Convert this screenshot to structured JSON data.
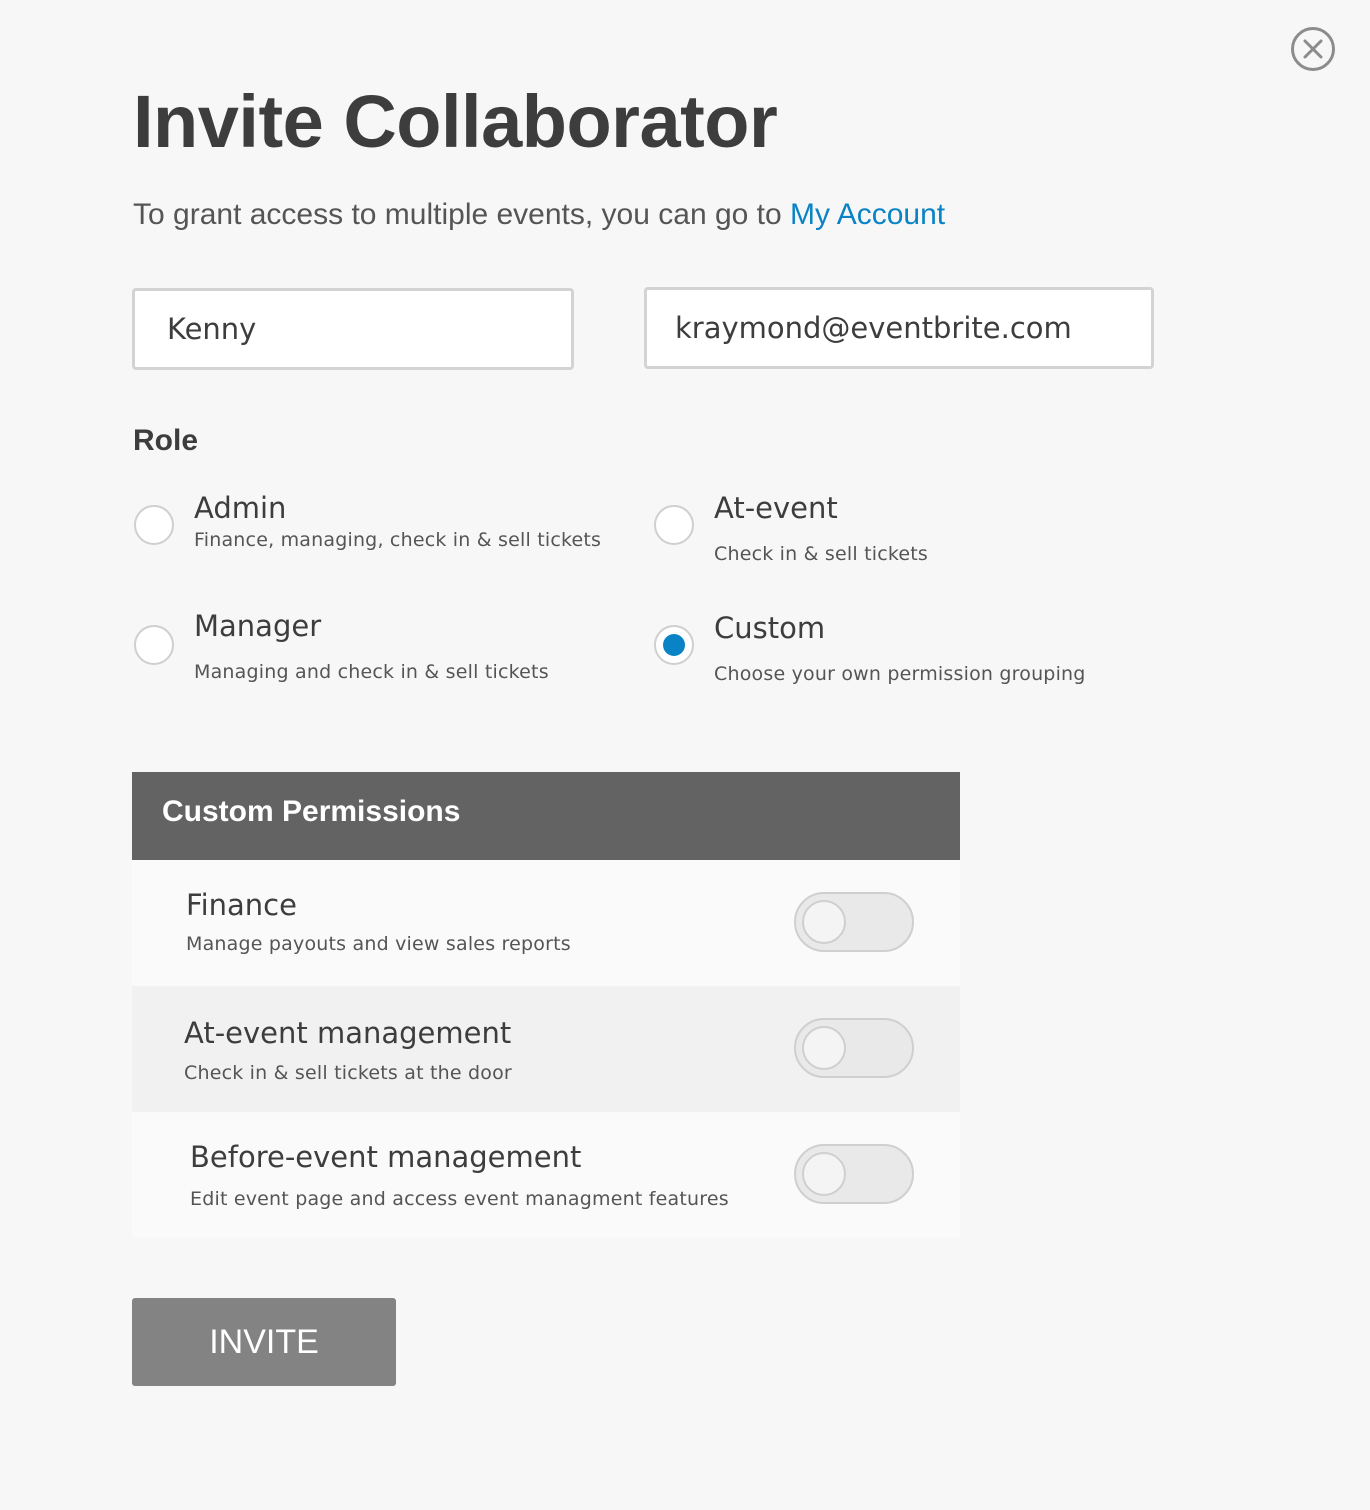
{
  "dialog": {
    "title": "Invite Collaborator",
    "subtitle_text": "To grant access to multiple events, you can go to ",
    "subtitle_link": "My Account",
    "close_icon": "close-icon"
  },
  "form": {
    "name_value": "Kenny",
    "email_value": "kraymond@eventbrite.com"
  },
  "role": {
    "label": "Role",
    "selected": "Custom",
    "options": [
      {
        "title": "Admin",
        "description": "Finance, managing, check in & sell tickets",
        "checked": false
      },
      {
        "title": "At-event",
        "description": "Check in & sell tickets",
        "checked": false
      },
      {
        "title": "Manager",
        "description": "Managing and check in & sell tickets",
        "checked": false
      },
      {
        "title": "Custom",
        "description": "Choose your own permission grouping",
        "checked": true
      }
    ]
  },
  "permissions": {
    "header": "Custom Permissions",
    "items": [
      {
        "title": "Finance",
        "description": "Manage payouts and view sales reports",
        "enabled": false
      },
      {
        "title": "At-event management",
        "description": "Check in & sell tickets at the door",
        "enabled": false
      },
      {
        "title": "Before-event management",
        "description": "Edit event page and access event managment features",
        "enabled": false
      }
    ]
  },
  "actions": {
    "invite_label": "INVITE"
  },
  "colors": {
    "accent": "#0a83c6",
    "header_bg": "#636363",
    "button_bg": "#838383"
  }
}
